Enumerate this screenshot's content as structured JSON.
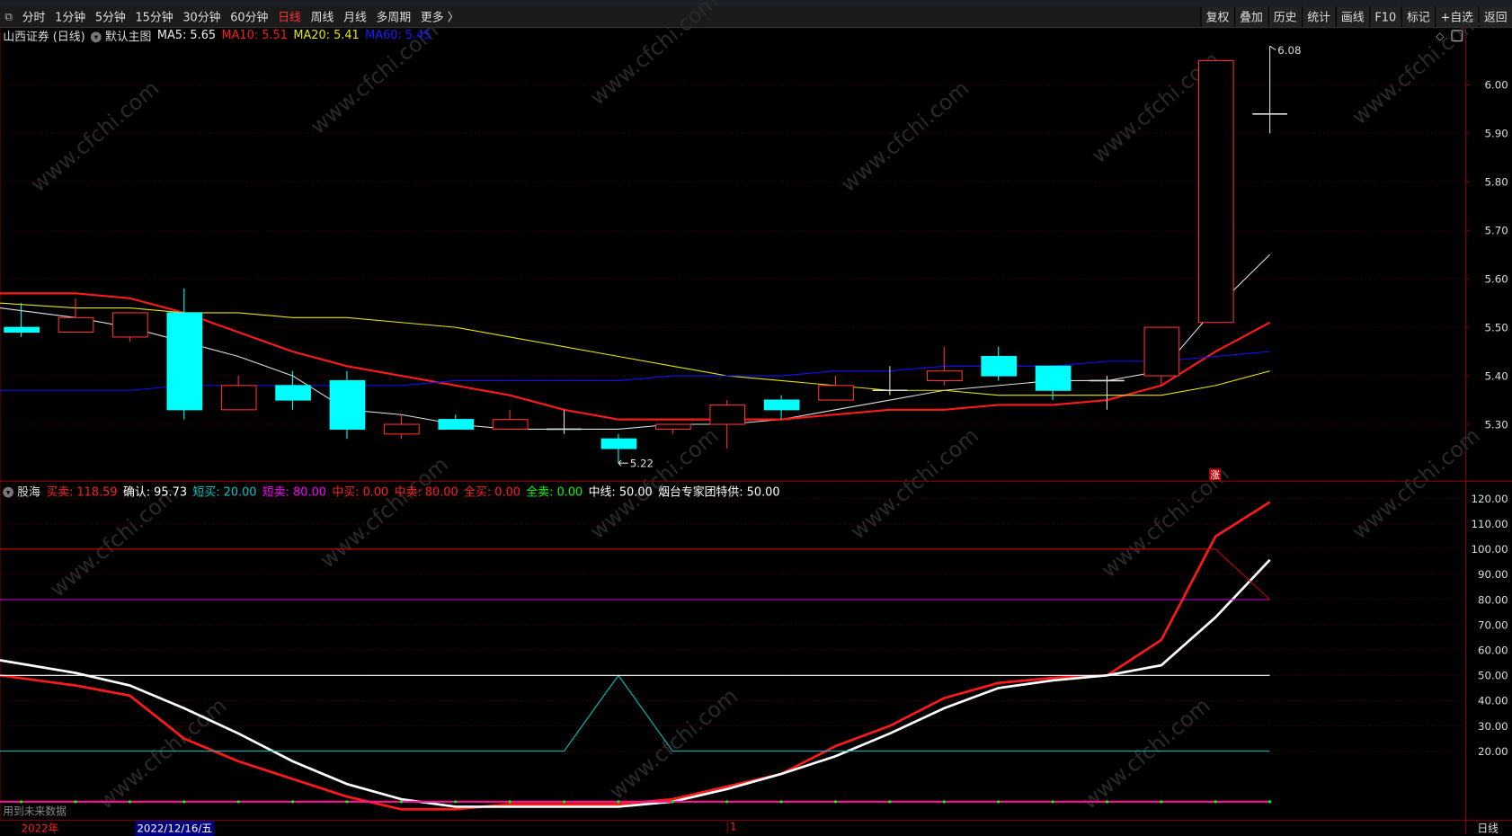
{
  "toolbar": {
    "periods": [
      "分时",
      "1分钟",
      "5分钟",
      "15分钟",
      "30分钟",
      "60分钟",
      "日线",
      "周线",
      "月线",
      "多周期",
      "更多 〉"
    ],
    "active_period": "日线",
    "buttons": [
      "复权",
      "叠加",
      "历史",
      "统计",
      "画线",
      "F10",
      "标记",
      "+自选",
      "返回"
    ]
  },
  "legend": {
    "stock": "山西证券 (日线)",
    "template": "默认主图",
    "ma5": "MA5: 5.65",
    "ma10": "MA10: 5.51",
    "ma20": "MA20: 5.41",
    "ma60": "MA60: 5.45"
  },
  "indicator_legend": {
    "name": "股海",
    "items": [
      {
        "text": "买卖: 118.59",
        "color": "#ff2020"
      },
      {
        "text": "确认: 95.73",
        "color": "#ffffff"
      },
      {
        "text": "短买: 20.00",
        "color": "#00c8c8"
      },
      {
        "text": "短卖: 80.00",
        "color": "#ff00ff"
      },
      {
        "text": "中买: 0.00",
        "color": "#ff2020"
      },
      {
        "text": "中卖: 80.00",
        "color": "#ff2020"
      },
      {
        "text": "全买: 0.00",
        "color": "#ff2020"
      },
      {
        "text": "全卖: 0.00",
        "color": "#00ff00"
      },
      {
        "text": "中线: 50.00",
        "color": "#ffffff"
      },
      {
        "text": "烟台专家团特供: 50.00",
        "color": "#ffffff"
      }
    ]
  },
  "annotations": {
    "high": "6.08",
    "low": "5.22",
    "rise_marker": "涨",
    "future_data": "用到未来数据"
  },
  "bottom": {
    "year": "2022年",
    "date": "2022/12/16/五",
    "mark": "1",
    "period": "日线"
  },
  "watermark": "www.cfchi.com",
  "chart_data": [
    {
      "type": "candlestick",
      "title": "山西证券 (日线)",
      "price_ticks": [
        6.0,
        5.9,
        5.8,
        5.7,
        5.6,
        5.5,
        5.4,
        5.3
      ],
      "ylim": [
        5.18,
        6.12
      ],
      "candles": [
        [
          5.5,
          5.55,
          5.48,
          5.49
        ],
        [
          5.49,
          5.56,
          5.49,
          5.52
        ],
        [
          5.48,
          5.53,
          5.47,
          5.53
        ],
        [
          5.53,
          5.58,
          5.31,
          5.33
        ],
        [
          5.33,
          5.4,
          5.33,
          5.38
        ],
        [
          5.38,
          5.41,
          5.33,
          5.35
        ],
        [
          5.39,
          5.41,
          5.27,
          5.29
        ],
        [
          5.28,
          5.32,
          5.27,
          5.3
        ],
        [
          5.31,
          5.32,
          5.29,
          5.29
        ],
        [
          5.29,
          5.33,
          5.29,
          5.31
        ],
        [
          5.29,
          5.33,
          5.28,
          5.29
        ],
        [
          5.27,
          5.28,
          5.22,
          5.25
        ],
        [
          5.29,
          5.3,
          5.28,
          5.3
        ],
        [
          5.3,
          5.35,
          5.25,
          5.34
        ],
        [
          5.35,
          5.36,
          5.31,
          5.33
        ],
        [
          5.35,
          5.4,
          5.35,
          5.38
        ],
        [
          5.37,
          5.42,
          5.36,
          5.37
        ],
        [
          5.39,
          5.46,
          5.38,
          5.41
        ],
        [
          5.44,
          5.46,
          5.39,
          5.4
        ],
        [
          5.42,
          5.42,
          5.35,
          5.37
        ],
        [
          5.39,
          5.4,
          5.33,
          5.39
        ],
        [
          5.4,
          5.5,
          5.38,
          5.5
        ],
        [
          5.51,
          6.05,
          5.51,
          6.05
        ],
        [
          5.94,
          6.08,
          5.9,
          5.94
        ]
      ],
      "series": [
        {
          "name": "MA5",
          "color": "#e0e0e0",
          "values": [
            5.54,
            5.52,
            5.5,
            5.47,
            5.44,
            5.4,
            5.33,
            5.32,
            5.3,
            5.29,
            5.29,
            5.29,
            5.3,
            5.3,
            5.31,
            5.33,
            5.35,
            5.37,
            5.38,
            5.39,
            5.39,
            5.41,
            5.54,
            5.65
          ]
        },
        {
          "name": "MA10",
          "color": "#ff1a1a",
          "values": [
            5.57,
            5.57,
            5.56,
            5.53,
            5.49,
            5.45,
            5.42,
            5.4,
            5.38,
            5.36,
            5.33,
            5.31,
            5.31,
            5.31,
            5.31,
            5.32,
            5.33,
            5.33,
            5.34,
            5.34,
            5.35,
            5.38,
            5.45,
            5.51
          ]
        },
        {
          "name": "MA20",
          "color": "#e6e600",
          "values": [
            5.55,
            5.54,
            5.54,
            5.53,
            5.53,
            5.52,
            5.52,
            5.51,
            5.5,
            5.48,
            5.46,
            5.44,
            5.42,
            5.4,
            5.39,
            5.38,
            5.37,
            5.37,
            5.36,
            5.36,
            5.36,
            5.36,
            5.38,
            5.41
          ]
        },
        {
          "name": "MA60",
          "color": "#1010ff",
          "values": [
            5.37,
            5.37,
            5.37,
            5.38,
            5.38,
            5.38,
            5.38,
            5.38,
            5.39,
            5.39,
            5.39,
            5.39,
            5.4,
            5.4,
            5.4,
            5.41,
            5.41,
            5.42,
            5.42,
            5.42,
            5.43,
            5.43,
            5.44,
            5.45
          ]
        }
      ]
    },
    {
      "type": "line",
      "title": "股海",
      "y_ticks": [
        120,
        110,
        100,
        90,
        80,
        70,
        60,
        50,
        40,
        30,
        20
      ],
      "ylim": [
        -5,
        125
      ],
      "series": [
        {
          "name": "买卖",
          "color": "#ff1a1a",
          "values": [
            50,
            46,
            42,
            25,
            16,
            9,
            2,
            -3,
            -3,
            -1,
            -1,
            -1,
            1,
            6,
            11,
            22,
            30,
            41,
            47,
            49,
            50,
            64,
            105,
            118.59
          ]
        },
        {
          "name": "确认",
          "color": "#ffffff",
          "values": [
            56,
            51,
            46,
            37,
            27,
            16,
            7,
            1,
            -2,
            -2,
            -2,
            -2,
            0,
            5,
            11,
            18,
            27,
            37,
            45,
            48,
            50,
            54,
            73,
            95.73
          ]
        },
        {
          "name": "短买",
          "color": "#00c8c8",
          "values": [
            20,
            20,
            20,
            20,
            20,
            20,
            20,
            20,
            20,
            20,
            20,
            50,
            20,
            20,
            20,
            20,
            20,
            20,
            20,
            20,
            20,
            20,
            20,
            20
          ]
        },
        {
          "name": "短卖",
          "color": "#cc00cc",
          "values": [
            80,
            80,
            80,
            80,
            80,
            80,
            80,
            80,
            80,
            80,
            80,
            80,
            80,
            80,
            80,
            80,
            80,
            80,
            80,
            80,
            80,
            80,
            80,
            80
          ]
        },
        {
          "name": "中卖",
          "color": "#cc0000",
          "values": [
            100,
            100,
            100,
            100,
            100,
            100,
            100,
            100,
            100,
            100,
            100,
            100,
            100,
            100,
            100,
            100,
            100,
            100,
            100,
            100,
            100,
            100,
            100,
            80
          ]
        },
        {
          "name": "中线",
          "color": "#ffffff",
          "values": [
            50,
            50,
            50,
            50,
            50,
            50,
            50,
            50,
            50,
            50,
            50,
            50,
            50,
            50,
            50,
            50,
            50,
            50,
            50,
            50,
            50,
            50,
            50,
            50
          ]
        },
        {
          "name": "全买",
          "color": "#ff1493",
          "values": [
            0,
            0,
            0,
            0,
            0,
            0,
            0,
            0,
            0,
            0,
            0,
            0,
            0,
            0,
            0,
            0,
            0,
            0,
            0,
            0,
            0,
            0,
            0,
            0
          ]
        }
      ]
    }
  ]
}
